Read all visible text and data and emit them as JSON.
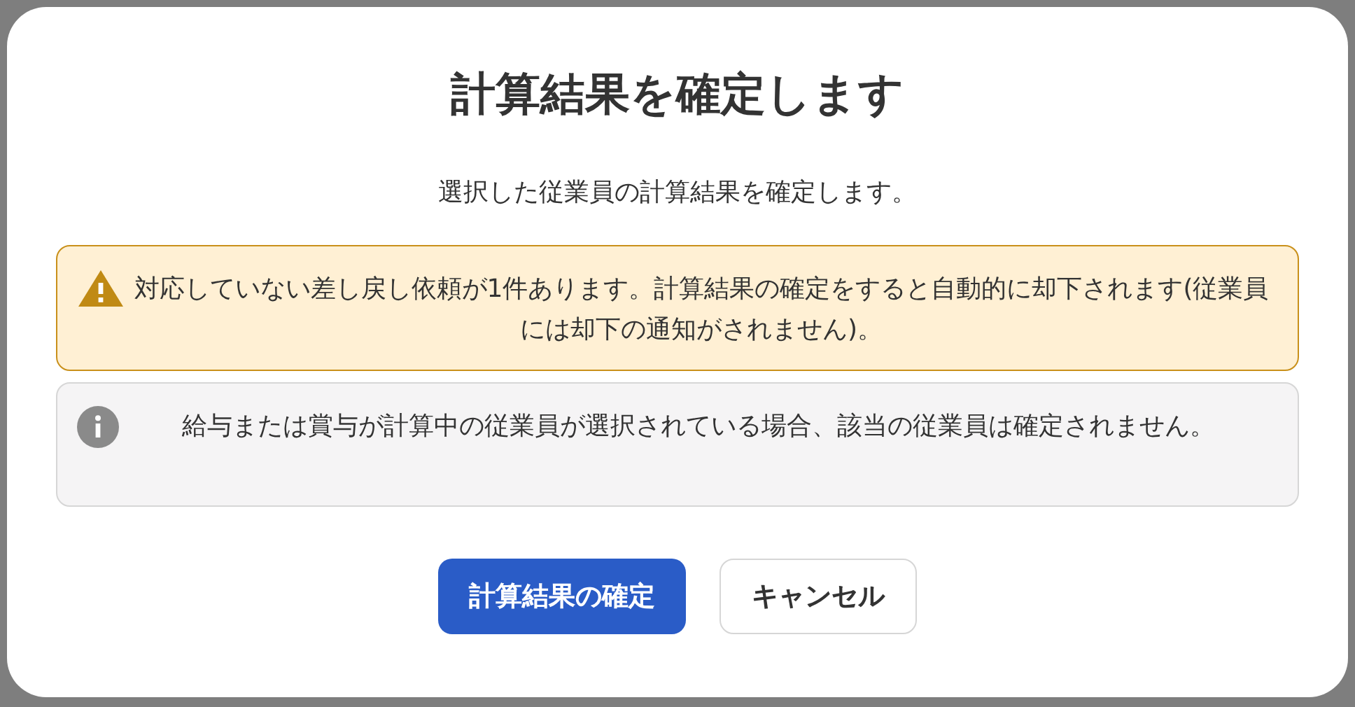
{
  "dialog": {
    "title": "計算結果を確定します",
    "message": "選択した従業員の計算結果を確定します。",
    "alerts": [
      {
        "kind": "warning",
        "text": "対応していない差し戻し依頼が1件あります。計算結果の確定をすると自動的に却下されます(従業員には却下の通知がされません)。"
      },
      {
        "kind": "info",
        "text": "給与または賞与が計算中の従業員が選択されている場合、該当の従業員は確定されません。"
      }
    ],
    "buttons": [
      {
        "kind": "primary",
        "label": "計算結果の確定"
      },
      {
        "kind": "secondary",
        "label": "キャンセル"
      }
    ]
  }
}
